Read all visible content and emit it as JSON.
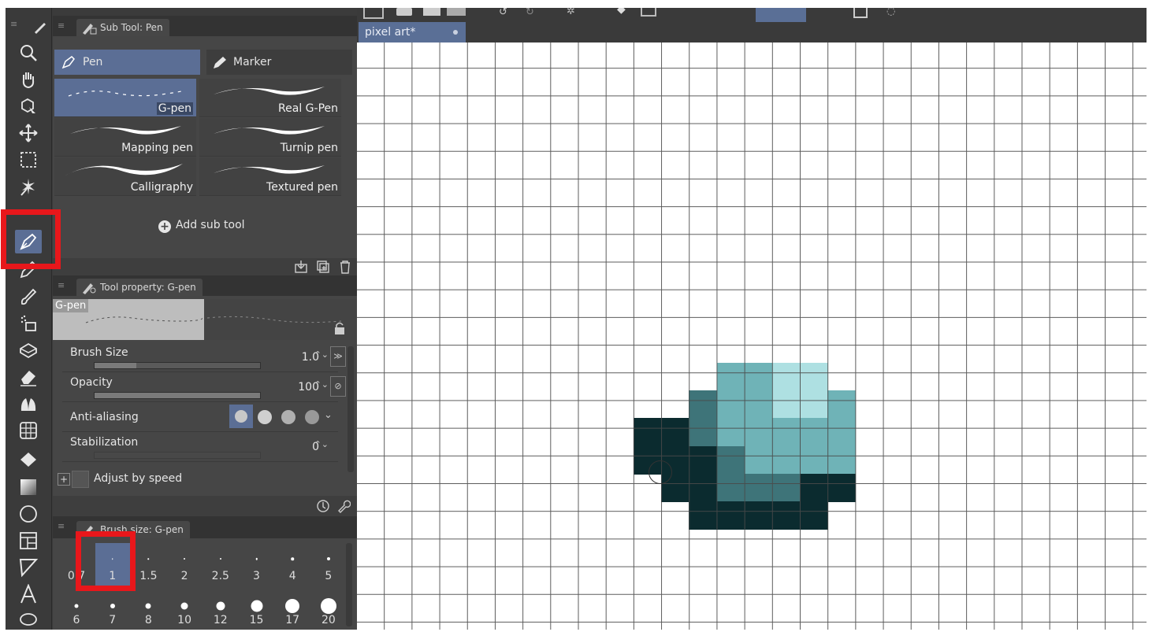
{
  "subtool_panel": {
    "title": "Sub Tool: Pen",
    "groups": [
      {
        "label": "Pen",
        "selected": true
      },
      {
        "label": "Marker",
        "selected": false
      }
    ],
    "brushes": [
      {
        "label": "G-pen",
        "selected": true
      },
      {
        "label": "Real G-Pen",
        "selected": false
      },
      {
        "label": "Mapping pen",
        "selected": false
      },
      {
        "label": "Turnip pen",
        "selected": false
      },
      {
        "label": "Calligraphy",
        "selected": false
      },
      {
        "label": "Textured pen",
        "selected": false
      }
    ],
    "add_label": "Add sub tool"
  },
  "tool_property": {
    "title": "Tool property: G-pen",
    "preview_label": "G-pen",
    "brush_size": {
      "label": "Brush Size",
      "value": "1.0",
      "fill": 0.25
    },
    "opacity": {
      "label": "Opacity",
      "value": "100",
      "fill": 1.0
    },
    "anti_aliasing": {
      "label": "Anti-aliasing"
    },
    "stabilization": {
      "label": "Stabilization",
      "value": "0",
      "fill": 0
    },
    "adjust": {
      "label": "Adjust by speed"
    }
  },
  "brush_size_panel": {
    "title": "Brush size: G-pen",
    "sizes": [
      "0.7",
      "1",
      "1.5",
      "2",
      "2.5",
      "3",
      "4",
      "5",
      "6",
      "7",
      "8",
      "10",
      "12",
      "15",
      "17",
      "20"
    ],
    "selected": "1"
  },
  "document": {
    "tab_label": "pixel art*"
  },
  "colors": {
    "dark": "#0b2b2f",
    "mid": "#3e7479",
    "teal": "#6fb3b7",
    "light": "#aee0e2",
    "highlight": "#e8171b",
    "selection": "#5b6e95"
  }
}
